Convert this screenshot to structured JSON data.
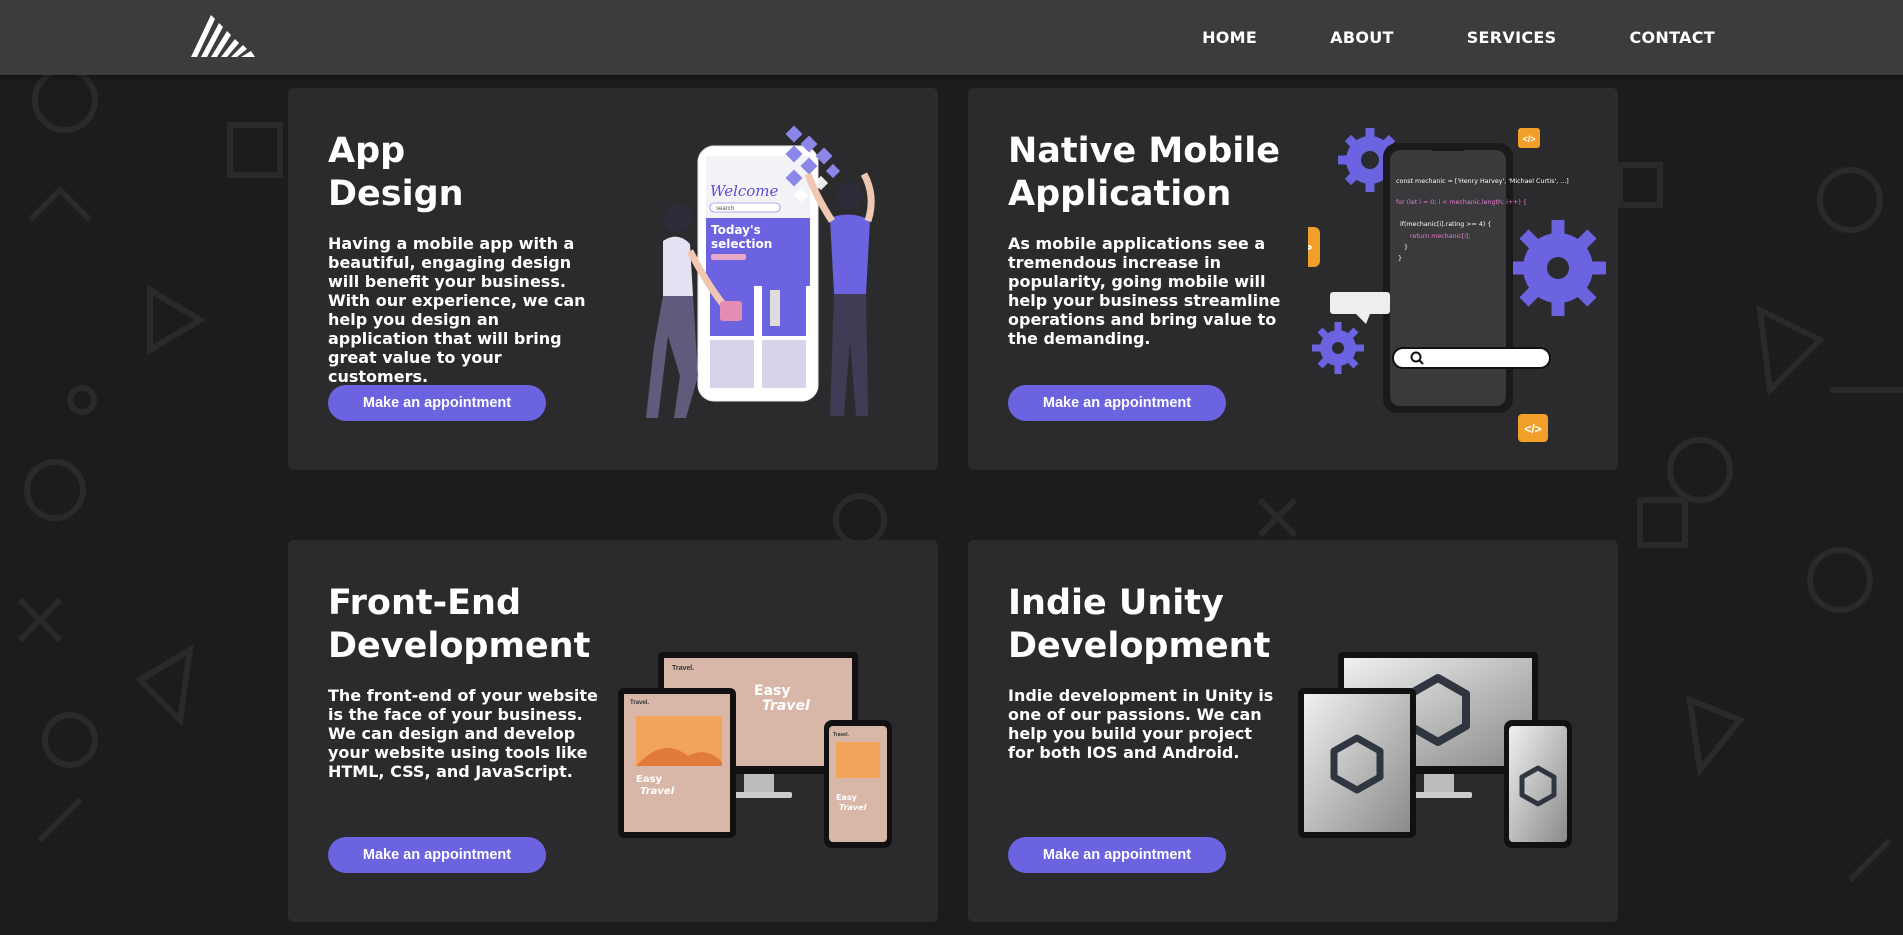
{
  "nav": {
    "items": [
      "HOME",
      "ABOUT",
      "SERVICES",
      "CONTACT"
    ]
  },
  "cards": [
    {
      "title_line1": "App",
      "title_line2": "Design",
      "body": "Having a mobile app with a beautiful, engaging design will benefit your business. With our experience, we can help you design an application that will bring great value to your customers.",
      "button": "Make an appointment",
      "art": {
        "welcome": "Welcome",
        "search": "search",
        "selection_line1": "Today's",
        "selection_line2": "selection"
      }
    },
    {
      "title_line1": "Native Mobile",
      "title_line2": "Application",
      "body": "As mobile applications see a tremendous increase in popularity, going mobile will help your business streamline operations and bring value to the demanding.",
      "button": "Make an appointment",
      "art": {
        "code_tag": "</>",
        "code1": "const mechanic = ['Henry Harvey', 'Michael Curtis', ...]",
        "code2": "for (let i = 0; i < mechanic.length; i++) {",
        "code3": "if(mechanic[i].rating >= 4) {",
        "code4": "return mechanic[i];",
        "code5": "}",
        "code6": "}"
      }
    },
    {
      "title_line1": "Front-End",
      "title_line2": "Development",
      "body": "The front-end of your website is the face of your business. We can design and develop your website using tools like HTML, CSS, and JavaScript.",
      "button": "Make an appointment",
      "art": {
        "brand": "Travel.",
        "headline1": "Easy",
        "headline2": "Travel"
      }
    },
    {
      "title_line1": "Indie Unity",
      "title_line2": "Development",
      "body": "Indie development in Unity is one of our passions. We can help you build your project for both IOS and Android.",
      "button": "Make an appointment"
    }
  ],
  "colors": {
    "accent": "#6b63e0",
    "card": "#2b2b2e",
    "topbar": "#3c3c3f",
    "background": "#1c1c1e",
    "orange": "#f0a02a"
  }
}
